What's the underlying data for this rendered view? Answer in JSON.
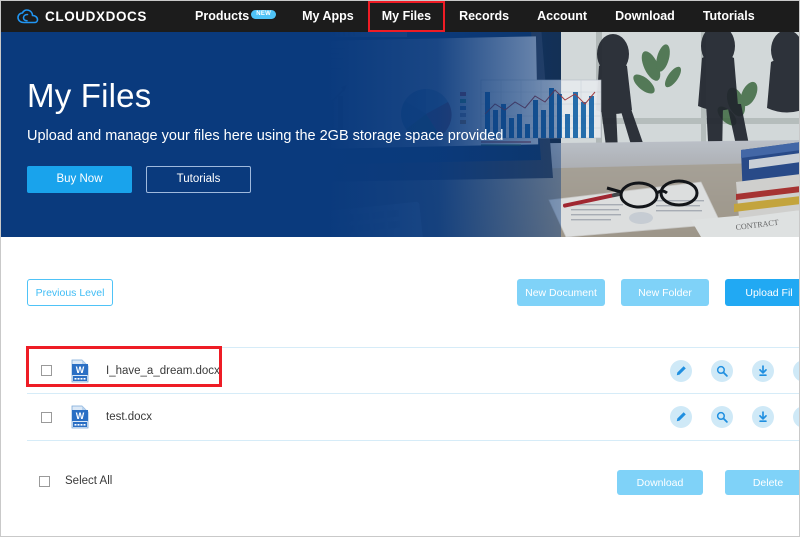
{
  "navbar": {
    "brand": {
      "name": "CLOUDXDOCS",
      "icon": "cloud-icon"
    },
    "links": [
      {
        "label": "Products",
        "badge": "NEW",
        "active": false
      },
      {
        "label": "My Apps",
        "badge": "",
        "active": false
      },
      {
        "label": "My Files",
        "badge": "",
        "active": true
      },
      {
        "label": "Records",
        "badge": "",
        "active": false
      },
      {
        "label": "Account",
        "badge": "",
        "active": false
      },
      {
        "label": "Download",
        "badge": "",
        "active": false
      },
      {
        "label": "Tutorials",
        "badge": "",
        "active": false
      }
    ],
    "background_color": "#1c1c1c",
    "highlight_color": "#ee1c25",
    "badge_color": "#4fc3f7"
  },
  "hero": {
    "title": "My Files",
    "subtitle": "Upload and manage your files here using the 2GB storage space provided",
    "buy_button": "Buy Now",
    "tutorials_button": "Tutorials",
    "background_color": "#0a3a7d",
    "accent_color": "#19a3ec"
  },
  "toolbar": {
    "previous_level": "Previous Level",
    "new_document": "New Document",
    "new_folder": "New Folder",
    "upload_files": "Upload Fil",
    "button_color": "#7fd2f8",
    "primary_color": "#21a9f3",
    "outline_color": "#4fc3f7"
  },
  "files": [
    {
      "name": "I_have_a_dream.docx",
      "type": "docx",
      "checked": false,
      "highlighted": true,
      "actions": [
        "edit-icon",
        "preview-icon",
        "download-icon",
        "delete-icon"
      ]
    },
    {
      "name": "test.docx",
      "type": "docx",
      "checked": false,
      "highlighted": false,
      "actions": [
        "edit-icon",
        "preview-icon",
        "download-icon",
        "delete-icon"
      ]
    }
  ],
  "footer": {
    "select_all": "Select All",
    "download": "Download",
    "delete": "Delete",
    "button_color": "#7fd2f8"
  }
}
